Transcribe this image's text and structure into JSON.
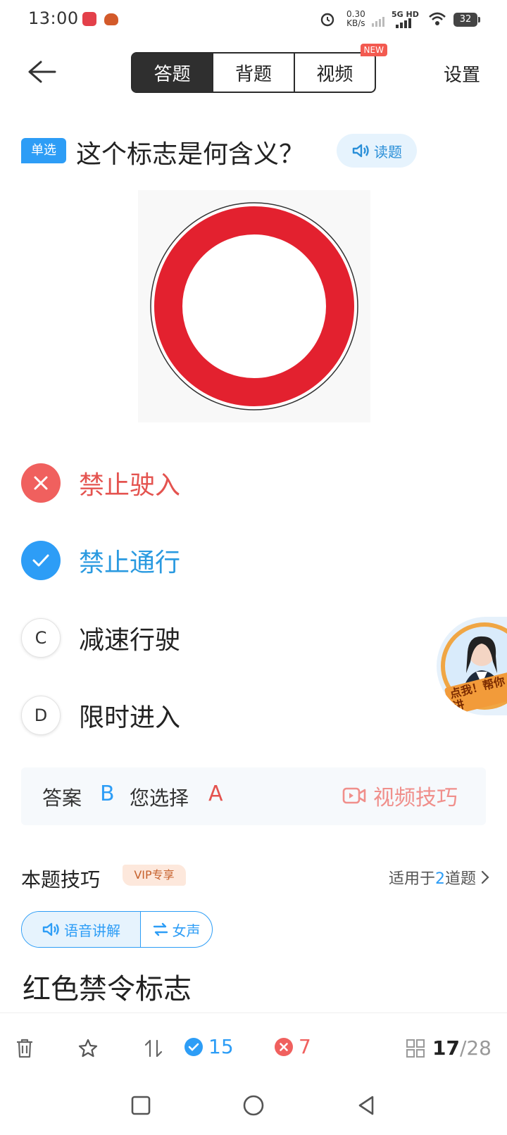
{
  "status": {
    "time": "13:00",
    "speed_value": "0.30",
    "speed_unit": "KB/s",
    "network": "5G HD",
    "battery": "32"
  },
  "header": {
    "tabs": [
      {
        "label": "答题",
        "active": true
      },
      {
        "label": "背题",
        "active": false
      },
      {
        "label": "视频",
        "active": false,
        "badge": "NEW"
      }
    ],
    "settings_label": "设置"
  },
  "question": {
    "type_label": "单选",
    "text": "这个标志是何含义？",
    "read_label": "读题",
    "sign_icon": "red-prohibition-ring-sign"
  },
  "options": [
    {
      "key": "A",
      "text": "禁止驶入",
      "state": "wrong"
    },
    {
      "key": "B",
      "text": "禁止通行",
      "state": "correct"
    },
    {
      "key": "C",
      "text": "减速行驶",
      "state": "normal"
    },
    {
      "key": "D",
      "text": "限时进入",
      "state": "normal"
    }
  ],
  "answer": {
    "answer_label": "答案",
    "answer_value": "B",
    "chosen_label": "您选择",
    "chosen_value": "A",
    "video_skill_label": "视频技巧"
  },
  "tip": {
    "title": "本题技巧",
    "vip_label": "VIP专享",
    "apply_prefix": "适用于",
    "apply_count": "2",
    "apply_suffix": "道题",
    "voice_label": "语音讲解",
    "gender_label": "女声",
    "content": "红色禁令标志"
  },
  "avatar": {
    "label": "点我！帮你讲"
  },
  "toolbar": {
    "correct_count": "15",
    "wrong_count": "7",
    "current": "17",
    "total": "/28"
  },
  "colors": {
    "accent_blue": "#2d9df6",
    "wrong_red": "#f0605e",
    "sign_red": "#e3212f"
  }
}
